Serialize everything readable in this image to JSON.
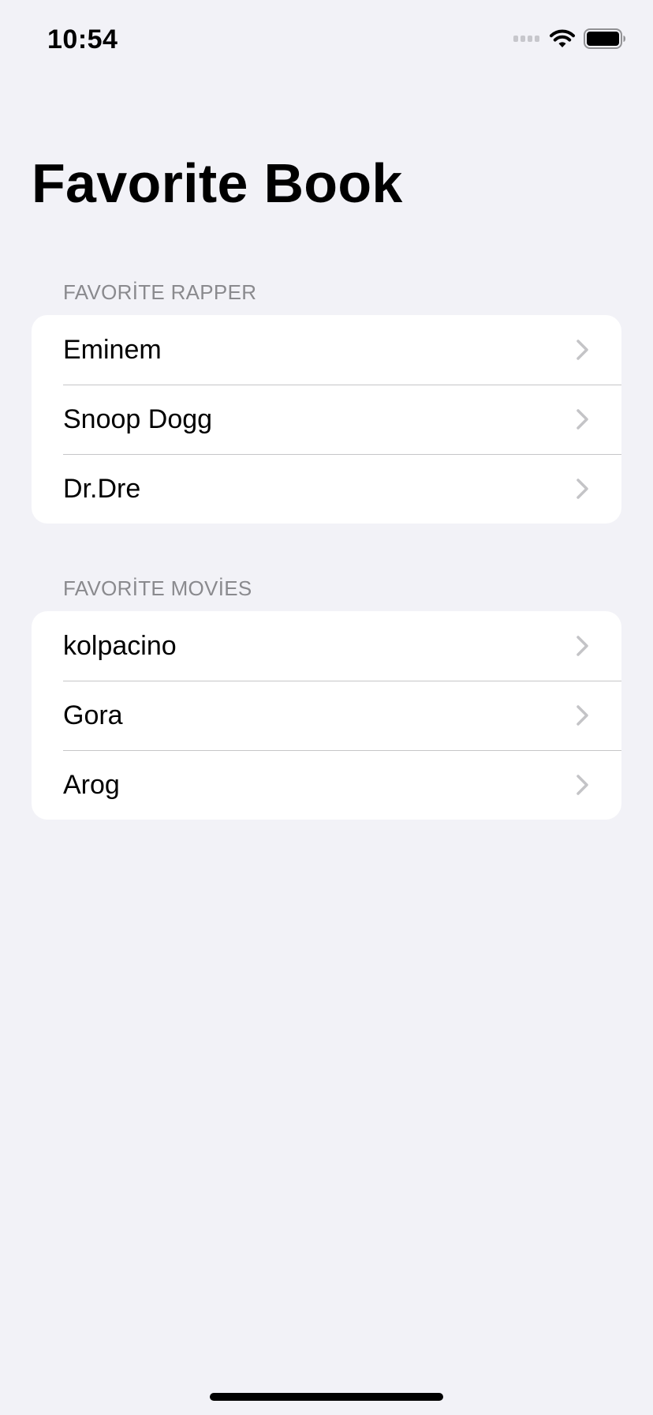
{
  "status_bar": {
    "time": "10:54",
    "icons": [
      "signal-icon",
      "wifi-icon",
      "battery-icon"
    ]
  },
  "title": "Favorite Book",
  "sections": [
    {
      "header": "FAVORİTE RAPPER",
      "items": [
        {
          "label": "Eminem"
        },
        {
          "label": "Snoop Dogg"
        },
        {
          "label": "Dr.Dre"
        }
      ]
    },
    {
      "header": "FAVORİTE MOVİES",
      "items": [
        {
          "label": "kolpacino"
        },
        {
          "label": "Gora"
        },
        {
          "label": "Arog"
        }
      ]
    }
  ],
  "colors": {
    "background": "#f2f2f7",
    "cell_background": "#ffffff",
    "section_header": "#8a8a8e",
    "separator": "#c6c6c8",
    "chevron": "#c4c4c7"
  }
}
